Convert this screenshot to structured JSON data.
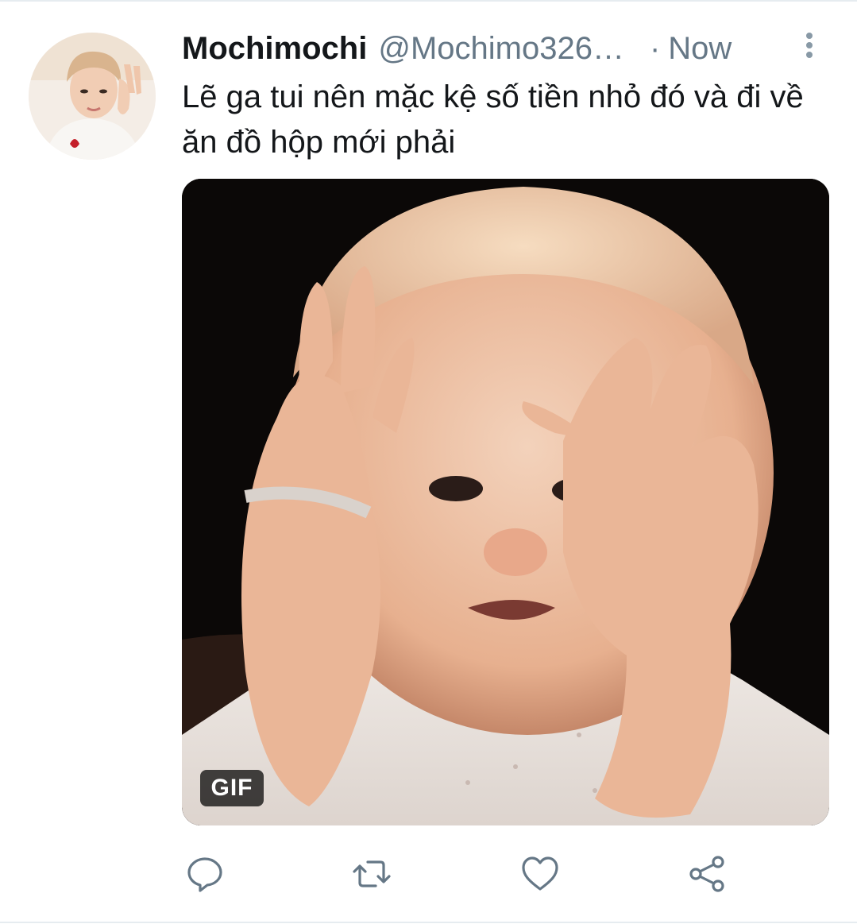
{
  "tweet": {
    "display_name": "Mochimochi",
    "handle": "@Mochimo326…",
    "separator": "·",
    "time": "Now",
    "text": "Lẽ ga tui nên mặc kệ số tiền nhỏ đó và đi về ăn đồ hộp mới phải",
    "media": {
      "badge": "GIF",
      "description_icon": "baby-holding-head-image"
    }
  },
  "actions": [
    {
      "icon": "reply-icon"
    },
    {
      "icon": "retweet-icon"
    },
    {
      "icon": "like-icon"
    },
    {
      "icon": "share-icon"
    }
  ],
  "colors": {
    "text_primary": "#14171a",
    "text_secondary": "#657786",
    "icon_gray": "#657786",
    "divider": "#e6ecf0"
  }
}
